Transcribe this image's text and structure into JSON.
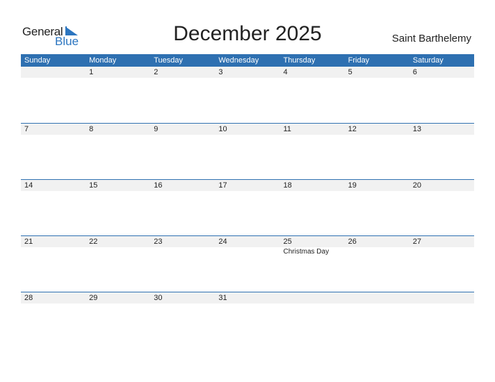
{
  "logo": {
    "general": "General",
    "blue": "Blue",
    "accent_color": "#2b75c0"
  },
  "title": "December 2025",
  "country": "Saint Barthelemy",
  "header_color": "#2e70b1",
  "weekdays": [
    "Sunday",
    "Monday",
    "Tuesday",
    "Wednesday",
    "Thursday",
    "Friday",
    "Saturday"
  ],
  "weeks": [
    {
      "days": [
        "",
        "1",
        "2",
        "3",
        "4",
        "5",
        "6"
      ],
      "events": [
        "",
        "",
        "",
        "",
        "",
        "",
        ""
      ]
    },
    {
      "days": [
        "7",
        "8",
        "9",
        "10",
        "11",
        "12",
        "13"
      ],
      "events": [
        "",
        "",
        "",
        "",
        "",
        "",
        ""
      ]
    },
    {
      "days": [
        "14",
        "15",
        "16",
        "17",
        "18",
        "19",
        "20"
      ],
      "events": [
        "",
        "",
        "",
        "",
        "",
        "",
        ""
      ]
    },
    {
      "days": [
        "21",
        "22",
        "23",
        "24",
        "25",
        "26",
        "27"
      ],
      "events": [
        "",
        "",
        "",
        "",
        "Christmas Day",
        "",
        ""
      ]
    },
    {
      "days": [
        "28",
        "29",
        "30",
        "31",
        "",
        "",
        ""
      ],
      "events": [
        "",
        "",
        "",
        "",
        "",
        "",
        ""
      ]
    }
  ]
}
